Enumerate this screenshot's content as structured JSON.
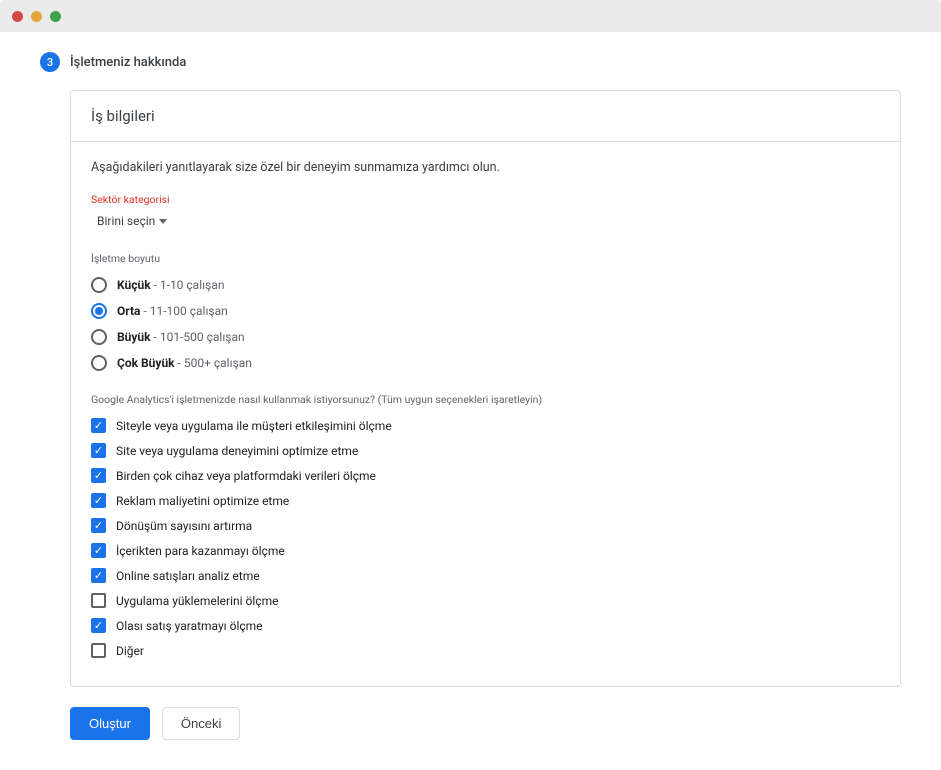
{
  "step": {
    "number": "3",
    "title": "İşletmeniz hakkında"
  },
  "card": {
    "title": "İş bilgileri",
    "intro": "Aşağıdakileri yanıtlayarak size özel bir deneyim sunmamıza yardımcı olun.",
    "industry": {
      "label": "Sektör kategorisi",
      "placeholder": "Birini seçin"
    },
    "size": {
      "label": "İşletme boyutu",
      "options": [
        {
          "name": "Küçük",
          "detail": " - 1-10 çalışan",
          "checked": false
        },
        {
          "name": "Orta",
          "detail": " - 11-100 çalışan",
          "checked": true
        },
        {
          "name": "Büyük",
          "detail": " - 101-500 çalışan",
          "checked": false
        },
        {
          "name": "Çok Büyük",
          "detail": " - 500+ çalışan",
          "checked": false
        }
      ]
    },
    "usage": {
      "label": "Google Analytics'i işletmenizde nasıl kullanmak istiyorsunuz? (Tüm uygun seçenekleri işaretleyin)",
      "options": [
        {
          "label": "Siteyle veya uygulama ile müşteri etkileşimini ölçme",
          "checked": true
        },
        {
          "label": "Site veya uygulama deneyimini optimize etme",
          "checked": true
        },
        {
          "label": "Birden çok cihaz veya platformdaki verileri ölçme",
          "checked": true
        },
        {
          "label": "Reklam maliyetini optimize etme",
          "checked": true
        },
        {
          "label": "Dönüşüm sayısını artırma",
          "checked": true
        },
        {
          "label": "İçerikten para kazanmayı ölçme",
          "checked": true
        },
        {
          "label": "Online satışları analiz etme",
          "checked": true
        },
        {
          "label": "Uygulama yüklemelerini ölçme",
          "checked": false
        },
        {
          "label": "Olası satış yaratmayı ölçme",
          "checked": true
        },
        {
          "label": "Diğer",
          "checked": false
        }
      ]
    }
  },
  "actions": {
    "primary": "Oluştur",
    "secondary": "Önceki"
  }
}
